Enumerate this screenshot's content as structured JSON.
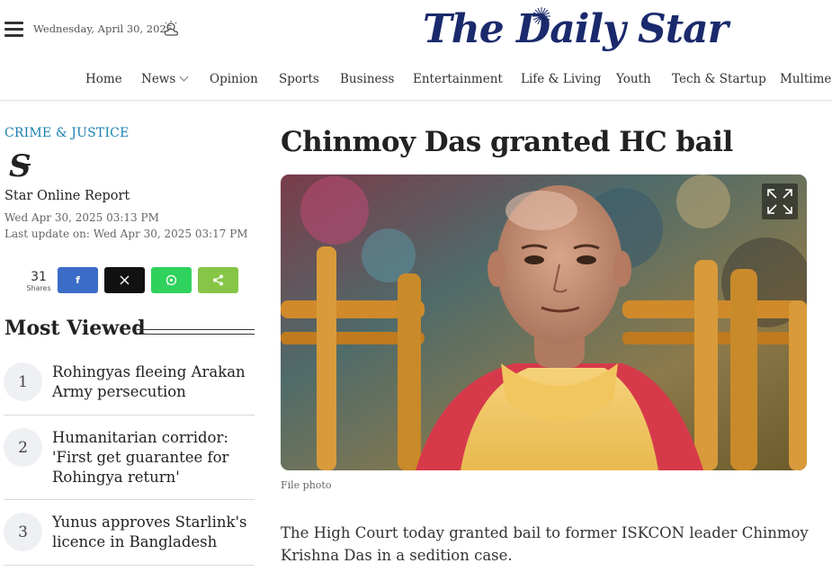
{
  "header": {
    "date": "Wednesday, April 30, 2025",
    "weather_icon": "cloud-sun-icon",
    "logo_text": "The Daily Star",
    "logo_color": "#1a2a6c"
  },
  "nav": {
    "items": [
      "Home",
      "News",
      "Opinion",
      "Sports",
      "Business",
      "Entertainment",
      "Life & Living",
      "Youth",
      "Tech & Startup",
      "Multimedia"
    ]
  },
  "article": {
    "category": "CRIME & JUSTICE",
    "category_color": "#1a7fb0",
    "author": "Star Online Report",
    "published": "Wed Apr 30, 2025 03:13 PM",
    "updated": "Last update on: Wed Apr 30, 2025 03:17 PM",
    "headline": "Chinmoy Das granted HC bail",
    "photo_caption": "File photo",
    "lead": "The High Court today granted bail to former ISKCON leader Chinmoy Krishna Das in a sedition case."
  },
  "share": {
    "count": "31",
    "label": "Shares",
    "buttons": [
      {
        "name": "facebook",
        "glyph": "f",
        "color": "#3b6cc7"
      },
      {
        "name": "x",
        "glyph": "𝕏",
        "color": "#111111"
      },
      {
        "name": "whatsapp",
        "glyph": "✆",
        "color": "#2fd25c"
      },
      {
        "name": "share",
        "glyph": "⋖",
        "color": "#86c546"
      }
    ]
  },
  "most_viewed": {
    "title": "Most Viewed",
    "items": [
      {
        "num": "1",
        "line1": "Rohingyas fleeing Arakan",
        "line2": "Army persecution",
        "line3": ""
      },
      {
        "num": "2",
        "line1": "Humanitarian corridor:",
        "line2": "'First get guarantee for",
        "line3": "Rohingya return'"
      },
      {
        "num": "3",
        "line1": "Yunus approves Starlink's",
        "line2": "licence in Bangladesh",
        "line3": ""
      }
    ]
  }
}
